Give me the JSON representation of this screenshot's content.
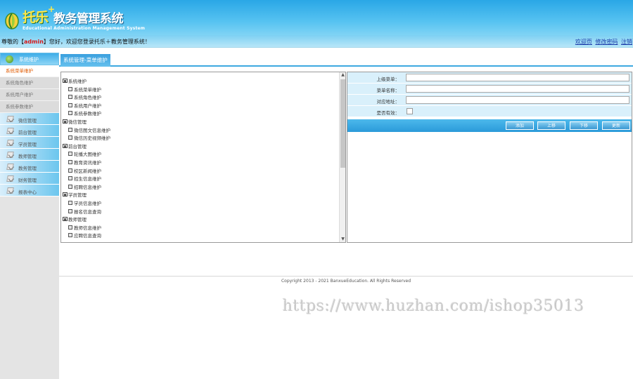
{
  "header": {
    "logo_brand": "托乐",
    "logo_plus": "+",
    "system_name": "教务管理系统",
    "system_name_en": "Educational Administration Management System"
  },
  "welcome": {
    "prefix": "尊敬的【",
    "username": "admin",
    "suffix": "】您好，欢迎您登录托乐＋教务管理系统！",
    "links": [
      "欢迎页",
      "修改密码",
      "注销"
    ]
  },
  "sidebar": {
    "header_label": "系统维护",
    "sub_items": [
      {
        "label": "系统菜单维护",
        "active": true
      },
      {
        "label": "系统角色维护",
        "active": false
      },
      {
        "label": "系统用户维护",
        "active": false
      },
      {
        "label": "系统参数维护",
        "active": false
      }
    ],
    "groups": [
      "微信管理",
      "前台管理",
      "学员管理",
      "教师管理",
      "教务管理",
      "财务管理",
      "报表中心"
    ]
  },
  "content": {
    "title": "系统管理-菜单维护"
  },
  "tree": {
    "nodes": [
      {
        "type": "folder",
        "label": "系统维护"
      },
      {
        "type": "leaf",
        "label": "系统菜单维护"
      },
      {
        "type": "leaf",
        "label": "系统角色维护"
      },
      {
        "type": "leaf",
        "label": "系统用户维护"
      },
      {
        "type": "leaf",
        "label": "系统参数维护"
      },
      {
        "type": "folder",
        "label": "微信管理"
      },
      {
        "type": "leaf",
        "label": "微信图文信息维护"
      },
      {
        "type": "leaf",
        "label": "微信历史视频维护"
      },
      {
        "type": "folder",
        "label": "前台管理"
      },
      {
        "type": "leaf",
        "label": "轮播大图维护"
      },
      {
        "type": "leaf",
        "label": "教育资讯维护"
      },
      {
        "type": "leaf",
        "label": "校区新闻维护"
      },
      {
        "type": "leaf",
        "label": "招生信息维护"
      },
      {
        "type": "leaf",
        "label": "招聘信息维护"
      },
      {
        "type": "folder",
        "label": "学员管理"
      },
      {
        "type": "leaf",
        "label": "学员信息维护"
      },
      {
        "type": "leaf",
        "label": "报名信息查询"
      },
      {
        "type": "folder",
        "label": "教师管理"
      },
      {
        "type": "leaf",
        "label": "教师信息维护"
      },
      {
        "type": "leaf",
        "label": "应聘信息查询"
      }
    ]
  },
  "form": {
    "fields": [
      {
        "label": "上级菜单：",
        "value": ""
      },
      {
        "label": "菜单名称：",
        "value": ""
      },
      {
        "label": "对应地址：",
        "value": ""
      }
    ],
    "checkbox_label": "是否有效：",
    "buttons": [
      "添加",
      "上移",
      "下移",
      "更新"
    ]
  },
  "footer": {
    "copyright": "Copyright 2013 - 2021 BanxueEducation. All Rights Reserved"
  },
  "watermark": "https://www.huzhan.com/ishop35013",
  "colors": {
    "header_blue": "#2aa7e6",
    "accent_orange": "#e05a00",
    "username_red": "#d81b1b",
    "link_blue": "#1a3aa8"
  }
}
